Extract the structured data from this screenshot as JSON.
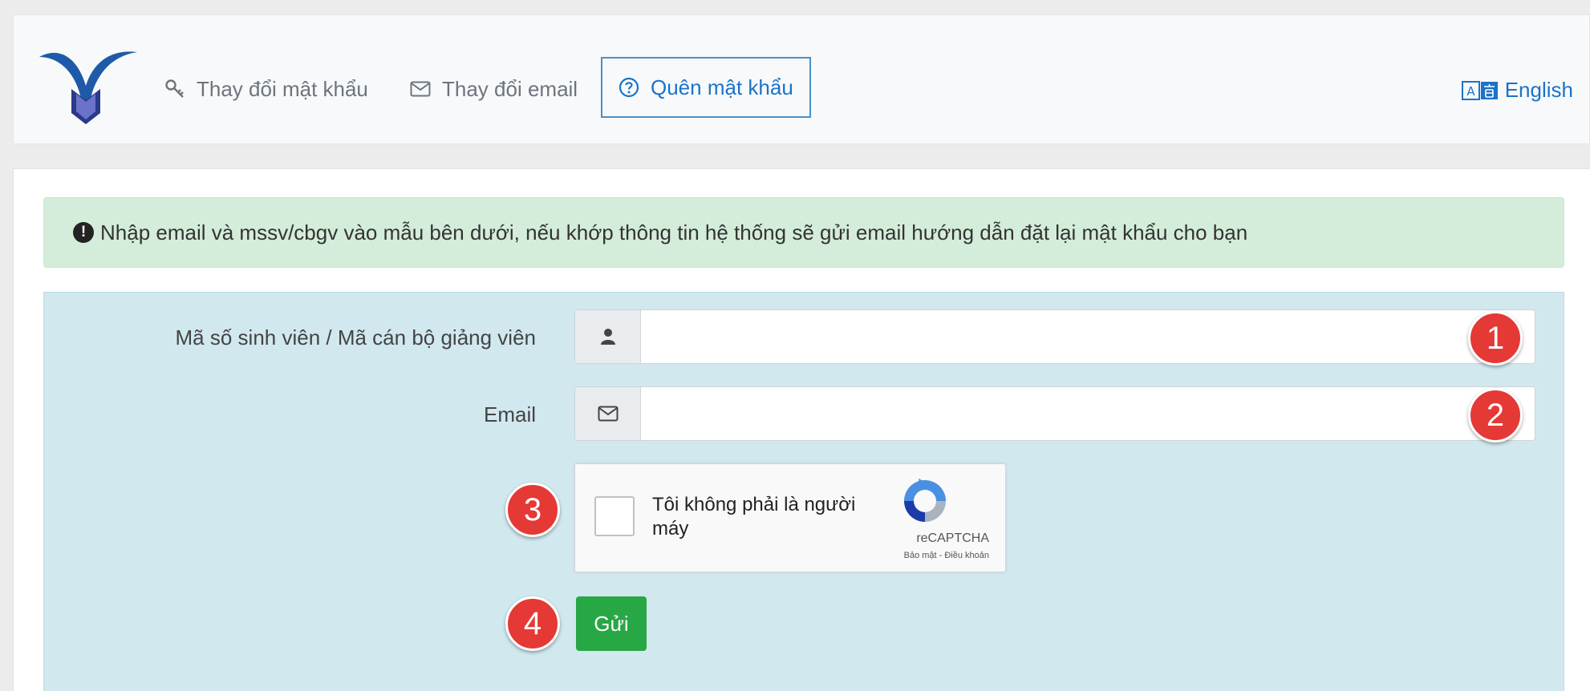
{
  "nav": {
    "change_password": "Thay đổi mật khẩu",
    "change_email": "Thay đổi email",
    "forgot_password": "Quên mật khẩu",
    "language": "English"
  },
  "alert": {
    "message": "Nhập email và mssv/cbgv vào mẫu bên dưới, nếu khớp thông tin hệ thống sẽ gửi email hướng dẫn đặt lại mật khẩu cho bạn"
  },
  "form": {
    "id_label": "Mã số sinh viên / Mã cán bộ giảng viên",
    "id_value": "",
    "email_label": "Email",
    "email_value": "",
    "submit_label": "Gửi"
  },
  "captcha": {
    "label": "Tôi không phải là người máy",
    "brand": "reCAPTCHA",
    "links": "Bảo mật - Điều khoản"
  },
  "badges": [
    "1",
    "2",
    "3",
    "4"
  ],
  "colors": {
    "accent": "#1a73c9",
    "success_bg": "#d4edda",
    "form_bg": "#d1e8ef",
    "button": "#28a745",
    "badge": "#e53935"
  }
}
